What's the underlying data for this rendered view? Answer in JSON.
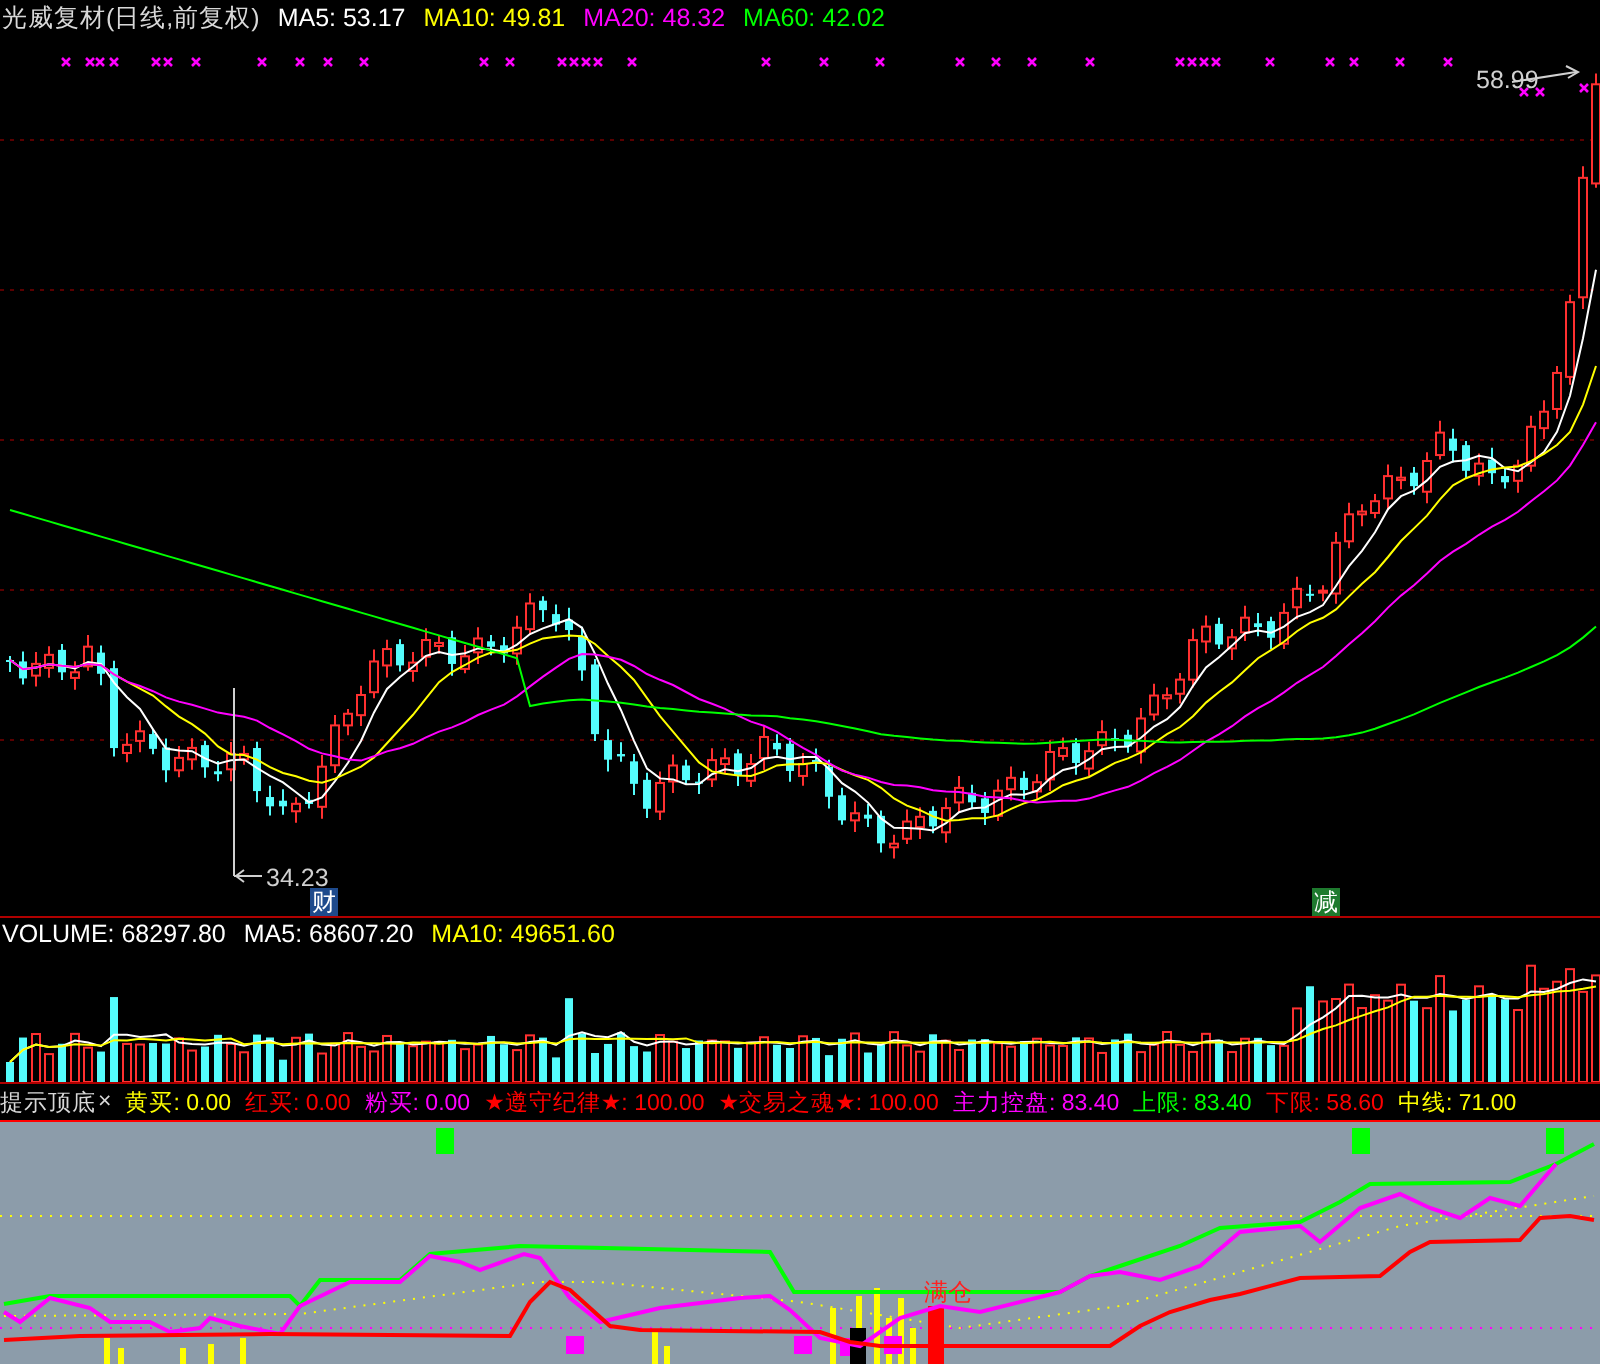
{
  "main_header": {
    "title": "光威复材(日线,前复权)",
    "ma": [
      {
        "label": "MA5: 53.17",
        "color": "#ffffff"
      },
      {
        "label": "MA10: 49.81",
        "color": "#ffff00"
      },
      {
        "label": "MA20: 48.32",
        "color": "#ff00ff"
      },
      {
        "label": "MA60: 42.02",
        "color": "#00ff00"
      }
    ]
  },
  "price_chart": {
    "high_label": "58.99",
    "low_label": "34.23",
    "events": [
      {
        "text": "财",
        "color": "#1e4a8c"
      },
      {
        "text": "减",
        "color": "#1e7a2e"
      }
    ]
  },
  "volume_header": {
    "items": [
      {
        "label": "VOLUME: 68297.80",
        "color": "#ffffff"
      },
      {
        "label": "MA5: 68607.20",
        "color": "#ffffff"
      },
      {
        "label": "MA10: 49651.60",
        "color": "#ffff00"
      }
    ]
  },
  "indicator_header": {
    "title": "提示顶底",
    "close": "×",
    "items": [
      {
        "label": "黄买: 0.00",
        "color": "#ffff00"
      },
      {
        "label": "红买: 0.00",
        "color": "#ff0000"
      },
      {
        "label": "粉买: 0.00",
        "color": "#ff00ff"
      },
      {
        "label": "★遵守纪律★: 100.00",
        "color": "#ff0000"
      },
      {
        "label": "★交易之魂★: 100.00",
        "color": "#ff0000"
      },
      {
        "label": "主力控盘: 83.40",
        "color": "#ff00ff"
      },
      {
        "label": "上限: 83.40",
        "color": "#00ff00"
      },
      {
        "label": "下限: 58.60",
        "color": "#ff0000"
      },
      {
        "label": "中线: 71.00",
        "color": "#ffff00"
      }
    ]
  },
  "indicator_panel": {
    "signal_label": "满仓"
  }
}
